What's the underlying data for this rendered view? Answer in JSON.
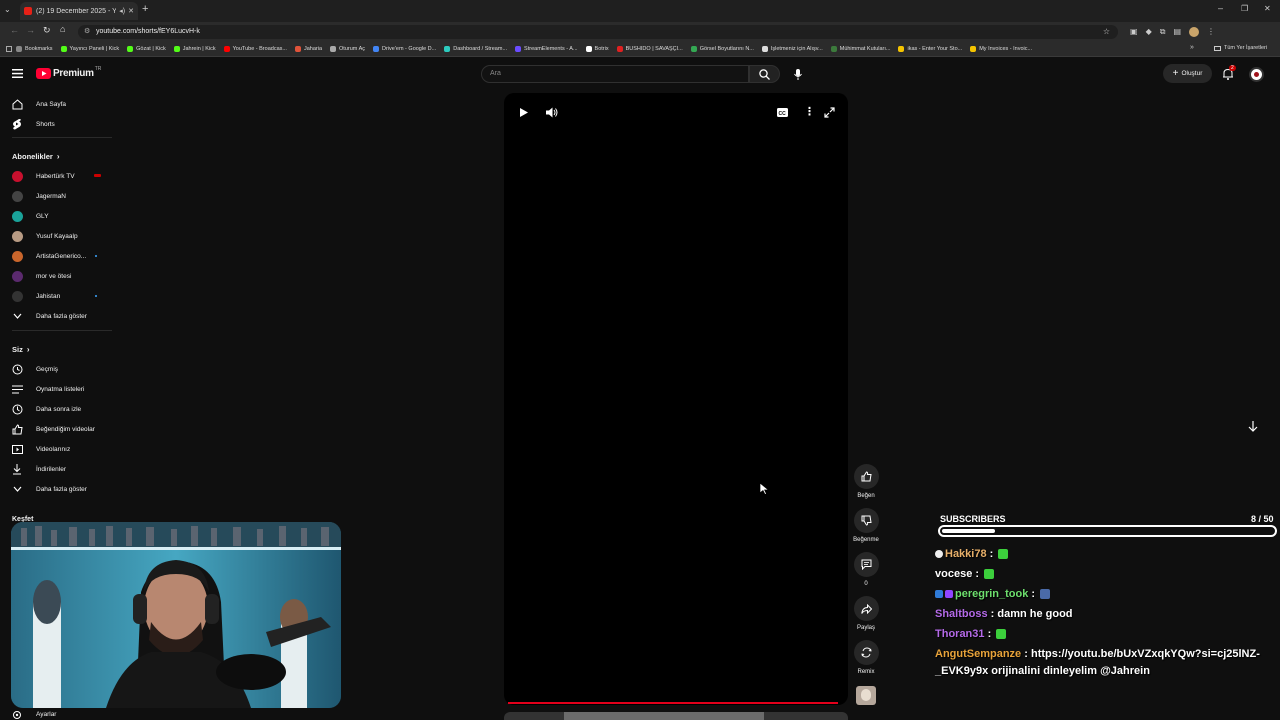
{
  "browser": {
    "tab_title": "(2) 19 December 2025 - Yo",
    "url": "youtube.com/shorts/fEY6LucvH-k",
    "new_tab": "+",
    "bookmarks": [
      {
        "label": "Bookmarks",
        "color": "#888888"
      },
      {
        "label": "Yayıncı Paneli | Kick",
        "color": "#53fc18"
      },
      {
        "label": "Gözat | Kick",
        "color": "#53fc18"
      },
      {
        "label": "Jahrein | Kick",
        "color": "#53fc18"
      },
      {
        "label": "YouTube - Broadcas...",
        "color": "#ff0000"
      },
      {
        "label": "Jaharia",
        "color": "#e0533a"
      },
      {
        "label": "Oturum Aç",
        "color": "#aaaaaa"
      },
      {
        "label": "Drive'em - Google D...",
        "color": "#4285f4"
      },
      {
        "label": "Dashboard / Stream...",
        "color": "#2dcbbf"
      },
      {
        "label": "StreamElements - A...",
        "color": "#6b4cff"
      },
      {
        "label": "Botrix",
        "color": "#ffffff"
      },
      {
        "label": "BUSHIDO | SAVAŞÇI...",
        "color": "#e02020"
      },
      {
        "label": "Görsel Boyutlarını N...",
        "color": "#34a853"
      },
      {
        "label": "İşletmeniz için Alışv...",
        "color": "#dddddd"
      },
      {
        "label": "Mühimmat Kutuları...",
        "color": "#3c7a3c"
      },
      {
        "label": "ikas - Enter Your Sto...",
        "color": "#f5c400"
      },
      {
        "label": "My Invoices - Invoic...",
        "color": "#f5c400"
      }
    ],
    "all_bookmarks": "Tüm Yer İşaretleri"
  },
  "header": {
    "logo_text": "Premium",
    "logo_sup": "TR",
    "search_placeholder": "Ara",
    "create_label": "Oluştur",
    "notif_count": "2"
  },
  "sidebar": {
    "main": [
      {
        "label": "Ana Sayfa",
        "icon": "home-icon"
      },
      {
        "label": "Shorts",
        "icon": "shorts-icon"
      }
    ],
    "subs_title": "Abonelikler",
    "subs": [
      {
        "label": "Habertürk TV",
        "color": "#c8102e",
        "live": true
      },
      {
        "label": "JagermaN",
        "color": "#444444",
        "live": false
      },
      {
        "label": "GLY",
        "color": "#1aa39a",
        "live": false
      },
      {
        "label": "Yusuf Kayaalp",
        "color": "#b89b84",
        "live": false
      },
      {
        "label": "ArtistaGenerico...",
        "color": "#c9662c",
        "live": false,
        "new": true
      },
      {
        "label": "mor ve ötesi",
        "color": "#5b2a6e",
        "live": false
      },
      {
        "label": "Jahistan",
        "color": "#333333",
        "live": false,
        "new": true
      }
    ],
    "subs_more": "Daha fazla göster",
    "you_title": "Siz",
    "you": [
      {
        "label": "Geçmiş",
        "icon": "history-icon"
      },
      {
        "label": "Oynatma listeleri",
        "icon": "playlist-icon"
      },
      {
        "label": "Daha sonra izle",
        "icon": "clock-icon"
      },
      {
        "label": "Beğendiğim videolar",
        "icon": "like-icon"
      },
      {
        "label": "Videolarınız",
        "icon": "video-icon"
      },
      {
        "label": "İndirilenler",
        "icon": "download-icon"
      }
    ],
    "you_more": "Daha fazla göster",
    "explore_title": "Keşfet",
    "bottom_label": "Ayarlar"
  },
  "actions": [
    {
      "label": "Beğen",
      "icon": "thumb-up-icon"
    },
    {
      "label": "Beğenme",
      "icon": "thumb-down-icon"
    },
    {
      "label": "0",
      "icon": "comment-icon"
    },
    {
      "label": "Paylaş",
      "icon": "share-icon"
    },
    {
      "label": "Remix",
      "icon": "remix-icon"
    }
  ],
  "overlay": {
    "subs_label": "SUBSCRIBERS",
    "subs_count": "8",
    "subs_total": "/ 50",
    "subs_fraction": 0.16,
    "chat": [
      {
        "user": "Hakki78",
        "color": "#e8b06a",
        "message": "",
        "emote": "green"
      },
      {
        "user": "vocese",
        "color": "#ffffff",
        "message": "",
        "emote": "green"
      },
      {
        "user": "peregrin_took",
        "color": "#6ee06e",
        "message": "",
        "emote": "blue"
      },
      {
        "user": "Shaltboss",
        "color": "#b46ae8",
        "message": "damn he good",
        "emote": ""
      },
      {
        "user": "Thoran31",
        "color": "#b46ae8",
        "message": "",
        "emote": "green"
      },
      {
        "user": "AngutSempanze",
        "color": "#e8a33a",
        "message": "https://youtu.be/bUxVZxqkYQw?si=cj25lNZ-_EVK9y9x orijinalini dinleyelim @Jahrein",
        "emote": ""
      }
    ]
  }
}
